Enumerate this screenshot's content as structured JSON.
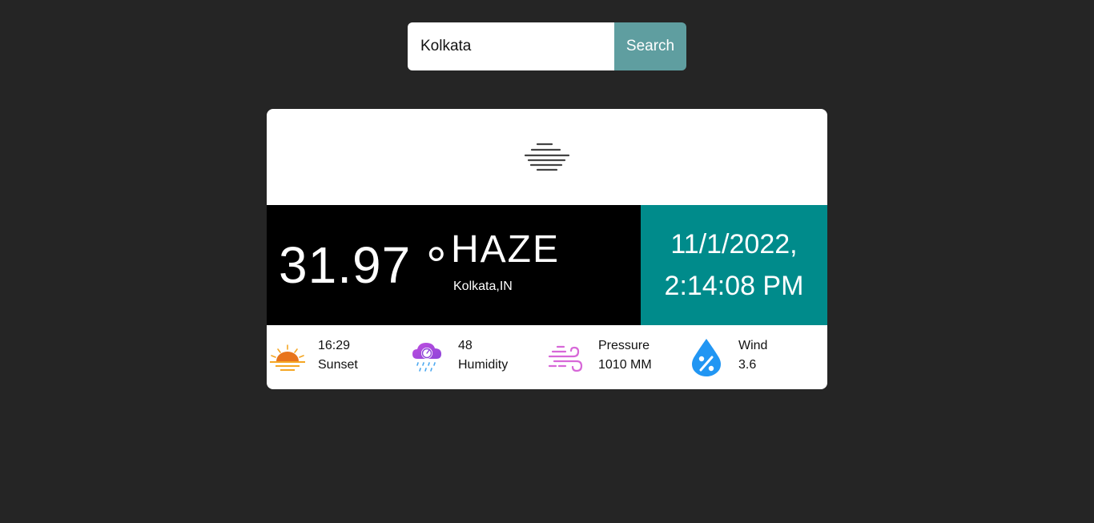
{
  "search": {
    "value": "Kolkata",
    "button_label": "Search"
  },
  "weather": {
    "icon": "haze-icon",
    "temperature": "31.97 °",
    "condition": "HAZE",
    "location": "Kolkata,IN"
  },
  "datetime": {
    "date": "11/1/2022,",
    "time": "2:14:08 PM"
  },
  "stats": {
    "sunset": {
      "icon": "sunset-icon",
      "value": "16:29",
      "label": "Sunset"
    },
    "humidity": {
      "icon": "humidity-icon",
      "value": "48",
      "label": "Humidity"
    },
    "pressure": {
      "icon": "wind-icon",
      "label": "Pressure",
      "value": "1010 MM"
    },
    "wind": {
      "icon": "percent-drop-icon",
      "label": "Wind",
      "value": "3.6"
    }
  },
  "colors": {
    "page_bg": "#252525",
    "search_button": "#5f9ea0",
    "datetime_bg": "#008b8b",
    "temp_bg": "#000000"
  }
}
